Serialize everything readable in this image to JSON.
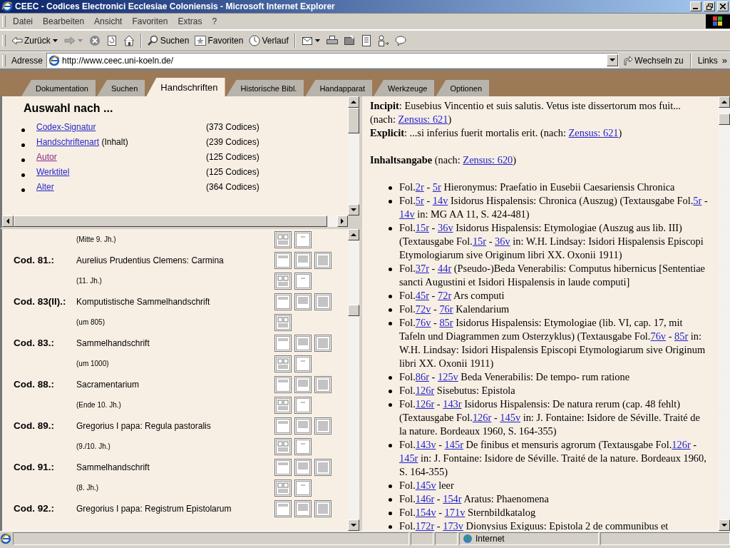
{
  "window": {
    "title": "CEEC - Codices Electronici Ecclesiae Coloniensis - Microsoft Internet Explorer"
  },
  "menu": [
    "Datei",
    "Bearbeiten",
    "Ansicht",
    "Favoriten",
    "Extras",
    "?"
  ],
  "toolbar": {
    "back": "Zurück",
    "search": "Suchen",
    "favorites": "Favoriten",
    "history": "Verlauf"
  },
  "address_bar": {
    "label": "Adresse",
    "url": "http://www.ceec.uni-koeln.de/",
    "go": "Wechseln zu",
    "links": "Links",
    "links_more": "»"
  },
  "tabs": [
    {
      "label": "Dokumentation",
      "selected": false
    },
    {
      "label": "Suchen",
      "selected": false
    },
    {
      "label": "Handschriften",
      "selected": true
    },
    {
      "label": "Historische Bibl.",
      "selected": false
    },
    {
      "label": "Handapparat",
      "selected": false
    },
    {
      "label": "Werkzeuge",
      "selected": false
    },
    {
      "label": "Optionen",
      "selected": false
    }
  ],
  "selection_panel": {
    "heading": "Auswahl nach ...",
    "items": [
      {
        "link": "Codex-Signatur",
        "count": "(373 Codices)",
        "visited": false
      },
      {
        "link": "Handschriftenart",
        "suffix": "(Inhalt)",
        "count": "(239 Codices)",
        "visited": false
      },
      {
        "link": "Autor",
        "count": "(125 Codices)",
        "visited": true
      },
      {
        "link": "Werktitel",
        "count": "(125 Codices)",
        "visited": false
      },
      {
        "link": "Alter",
        "count": "(364 Codices)",
        "visited": false
      }
    ]
  },
  "codex_list": {
    "rows": [
      {
        "kind": "date",
        "text": "(Mitte 9. Jh.)",
        "icons": [
          {
            "kind": "layout"
          },
          {
            "kind": "cover"
          }
        ]
      },
      {
        "kind": "title",
        "signature": "Cod. 81.:",
        "text": "Aurelius Prudentius Clemens: Carmina",
        "icons": [
          {
            "kind": "text-light"
          },
          {
            "kind": "text-medium"
          },
          {
            "kind": "text-dense"
          }
        ]
      },
      {
        "kind": "date",
        "text": "(11. Jh.)",
        "icons": [
          {
            "kind": "layout"
          },
          {
            "kind": "cover"
          }
        ]
      },
      {
        "kind": "title",
        "signature": "Cod. 83(II).:",
        "text": "Komputistische Sammelhandschrift",
        "icons": [
          {
            "kind": "text-light"
          },
          {
            "kind": "text-medium"
          },
          {
            "kind": "text-dense"
          }
        ]
      },
      {
        "kind": "date",
        "text": "(um 805)",
        "icons": [
          {
            "kind": "layout"
          }
        ]
      },
      {
        "kind": "title",
        "signature": "Cod. 83.:",
        "text": "Sammelhandschrift",
        "icons": [
          {
            "kind": "text-light"
          },
          {
            "kind": "text-medium"
          },
          {
            "kind": "text-dense"
          }
        ]
      },
      {
        "kind": "date",
        "text": "(um 1000)",
        "icons": [
          {
            "kind": "layout"
          },
          {
            "kind": "cover"
          }
        ]
      },
      {
        "kind": "title",
        "signature": "Cod. 88.:",
        "text": "Sacramentarium",
        "icons": [
          {
            "kind": "text-light"
          },
          {
            "kind": "text-medium"
          },
          {
            "kind": "text-dense"
          }
        ]
      },
      {
        "kind": "date",
        "text": "(Ende 10. Jh.)",
        "icons": [
          {
            "kind": "layout"
          },
          {
            "kind": "cover"
          }
        ]
      },
      {
        "kind": "title",
        "signature": "Cod. 89.:",
        "text": "Gregorius I papa: Regula pastoralis",
        "icons": [
          {
            "kind": "text-light"
          },
          {
            "kind": "text-medium"
          },
          {
            "kind": "text-dense"
          }
        ]
      },
      {
        "kind": "date",
        "text": "(9./10. Jh.)",
        "icons": [
          {
            "kind": "layout"
          },
          {
            "kind": "cover"
          }
        ]
      },
      {
        "kind": "title",
        "signature": "Cod. 91.:",
        "text": "Sammelhandschrift",
        "icons": [
          {
            "kind": "text-light"
          },
          {
            "kind": "text-medium"
          },
          {
            "kind": "text-dense"
          }
        ]
      },
      {
        "kind": "date",
        "text": "(8. Jh.)",
        "icons": [
          {
            "kind": "layout"
          },
          {
            "kind": "cover"
          }
        ]
      },
      {
        "kind": "title",
        "signature": "Cod. 92.:",
        "text": "Gregorius I papa: Registrum Epistolarum",
        "icons": [
          {
            "kind": "text-light"
          },
          {
            "kind": "text-medium"
          },
          {
            "kind": "text-dense"
          }
        ]
      }
    ]
  },
  "detail": {
    "lines": [
      {
        "parts": [
          "**Incipit**: Eusebius Vincentio et suis salutis. Vetus iste dissertorum mos fuit... (nach: ",
          {
            "link": "Zensus: 621"
          },
          ")"
        ]
      },
      {
        "parts": [
          "**Explicit**: ...si inferius fuerit mortalis erit. (nach: ",
          {
            "link": "Zensus: 621"
          },
          ")"
        ]
      }
    ],
    "contents_heading": {
      "parts": [
        "**Inhaltsangabe** (nach: ",
        {
          "link": "Zensus: 620"
        },
        ")"
      ]
    },
    "contents": [
      {
        "parts": [
          "Fol.",
          {
            "link": "2r"
          },
          " - ",
          {
            "link": "5r"
          },
          " Hieronymus: Praefatio in Eusebii Caesariensis Chronica"
        ]
      },
      {
        "parts": [
          "Fol.",
          {
            "link": "5r"
          },
          " - ",
          {
            "link": "14v"
          },
          " Isidorus Hispalensis: Chronica (Auszug) (Textausgabe Fol.",
          {
            "link": "5r"
          },
          " - ",
          {
            "link": "14v"
          },
          " in: MG AA 11, S. 424-481)"
        ]
      },
      {
        "parts": [
          "Fol.",
          {
            "link": "15r"
          },
          " - ",
          {
            "link": "36v"
          },
          " Isidorus Hispalensis: Etymologiae (Auszug aus lib. III) (Textausgabe Fol.",
          {
            "link": "15r"
          },
          " - ",
          {
            "link": "36v"
          },
          " in: W.H. Lindsay: Isidori Hispalensis Episcopi Etymologiarum sive Originum libri XX. Oxonii 1911)"
        ]
      },
      {
        "parts": [
          "Fol.",
          {
            "link": "37r"
          },
          " - ",
          {
            "link": "44r"
          },
          " (Pseudo-)Beda Venerabilis: Computus hibernicus [Sententiae sancti Augustini et Isidori Hispalensis in laude computi]"
        ]
      },
      {
        "parts": [
          "Fol.",
          {
            "link": "45r"
          },
          " - ",
          {
            "link": "72r"
          },
          " Ars computi"
        ]
      },
      {
        "parts": [
          "Fol.",
          {
            "link": "72v"
          },
          " - ",
          {
            "link": "76r"
          },
          " Kalendarium"
        ]
      },
      {
        "parts": [
          "Fol.",
          {
            "link": "76v"
          },
          " - ",
          {
            "link": "85r"
          },
          " Isidorus Hispalensis: Etymologiae (lib. VI, cap. 17, mit Tafeln und Diagrammen zum Osterzyklus) (Textausgabe Fol.",
          {
            "link": "76v"
          },
          " - ",
          {
            "link": "85r"
          },
          " in: W.H. Lindsay: Isidori Hispalensis Episcopi Etymologiarum sive Originum libri XX. Oxonii 1911)"
        ]
      },
      {
        "parts": [
          "Fol.",
          {
            "link": "86r"
          },
          " - ",
          {
            "link": "125v"
          },
          " Beda Venerabilis: De tempo- rum ratione"
        ]
      },
      {
        "parts": [
          "Fol.",
          {
            "link": "126r"
          },
          " Sisebutus: Epistola"
        ]
      },
      {
        "parts": [
          "Fol.",
          {
            "link": "126r"
          },
          " - ",
          {
            "link": "143r"
          },
          " Isidorus Hispalensis: De natura rerum (cap. 48 fehlt) (Textausgabe Fol.",
          {
            "link": "126r"
          },
          " - ",
          {
            "link": "145v"
          },
          " in: J. Fontaine: Isidore de Séville. Traité de la nature. Bordeaux 1960, S. 164-355)"
        ]
      },
      {
        "parts": [
          "Fol.",
          {
            "link": "143v"
          },
          " - ",
          {
            "link": "145r"
          },
          " De finibus et mensuris agrorum (Textausgabe Fol.",
          {
            "link": "126r"
          },
          " - ",
          {
            "link": "145r"
          },
          " in: J. Fontaine: Isidore de Séville. Traité de la nature. Bordeaux 1960, S. 164-355)"
        ]
      },
      {
        "parts": [
          "Fol.",
          {
            "link": "145v"
          },
          " leer"
        ]
      },
      {
        "parts": [
          "Fol.",
          {
            "link": "146r"
          },
          " - ",
          {
            "link": "154r"
          },
          " Aratus: Phaenomena"
        ]
      },
      {
        "parts": [
          "Fol.",
          {
            "link": "154v"
          },
          " - ",
          {
            "link": "171v"
          },
          " Sternbildkatalog"
        ]
      },
      {
        "parts": [
          "Fol.",
          {
            "link": "172r"
          },
          " - ",
          {
            "link": "173v"
          },
          " Dionysius Exiguus: Epistola 2 de communibus et"
        ]
      }
    ]
  },
  "status_bar": {
    "zone": "Internet"
  }
}
